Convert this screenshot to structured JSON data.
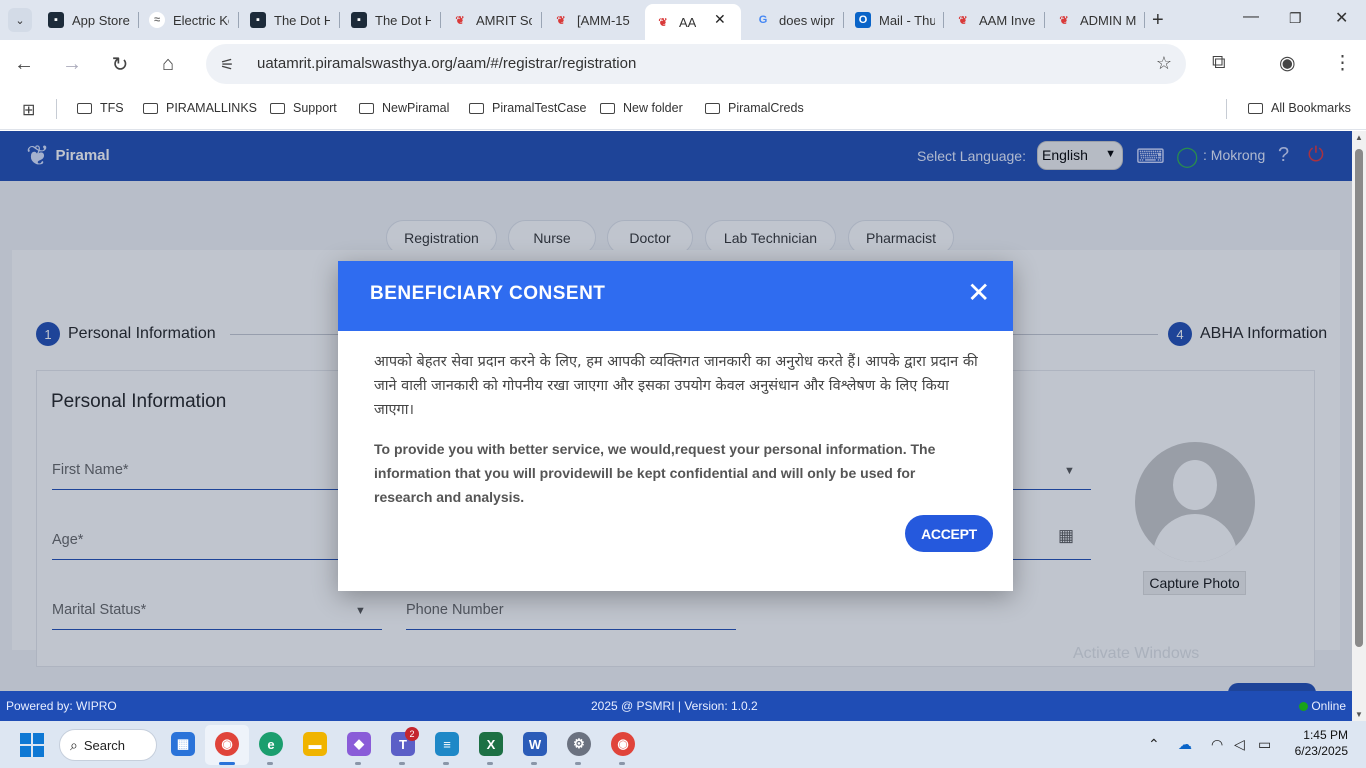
{
  "browser": {
    "tabs": [
      {
        "title": "App Store",
        "icon": "app-store-icon"
      },
      {
        "title": "Electric Ke",
        "icon": "electric-icon"
      },
      {
        "title": "The Dot H",
        "icon": "dot-icon"
      },
      {
        "title": "The Dot H",
        "icon": "dot-icon"
      },
      {
        "title": "AMRIT Sc",
        "icon": "amrit-icon"
      },
      {
        "title": "[AMM-15",
        "icon": "amrit-icon"
      },
      {
        "title": "AA",
        "icon": "amrit-icon",
        "active": true
      },
      {
        "title": "does wipr",
        "icon": "google-icon"
      },
      {
        "title": "Mail - Thu",
        "icon": "outlook-icon"
      },
      {
        "title": "AAM Inve",
        "icon": "amrit-icon"
      },
      {
        "title": "ADMIN M",
        "icon": "amrit-icon"
      }
    ],
    "close_glyph": "✕",
    "new_tab_glyph": "+",
    "url": "uatamrit.piramalswasthya.org/aam/#/registrar/registration",
    "bookmarks": [
      "TFS",
      "PIRAMALLINKS",
      "Support",
      "NewPiramal",
      "PiramalTestCase",
      "New folder",
      "PiramalCreds"
    ],
    "all_bookmarks": "All Bookmarks"
  },
  "app": {
    "brand": "Piramal",
    "language_label": "Select Language:",
    "language_value": "English",
    "user_label": ": Mokrong",
    "role_tabs": [
      "Registration",
      "Nurse",
      "Doctor",
      "Lab Technician",
      "Pharmacist"
    ],
    "steps": [
      {
        "num": "1",
        "label": "Personal Information"
      },
      {
        "num": "4",
        "label": "ABHA Information"
      }
    ],
    "form_title": "Personal Information",
    "fields": {
      "first_name": "First Name*",
      "age": "Age*",
      "marital_status": "Marital Status*",
      "phone_number": "Phone Number"
    },
    "capture_photo": "Capture Photo",
    "watermark": "Activate Windows",
    "footer": {
      "powered_by": "Powered by: WIPRO",
      "version": "2025 @ PSMRI  |  Version: 1.0.2",
      "status": "Online"
    }
  },
  "dialog": {
    "title": "BENEFICIARY CONSENT",
    "close_glyph": "✕",
    "hindi_text": "आपको बेहतर सेवा प्रदान करने के लिए, हम आपकी व्यक्तिगत जानकारी का अनुरोध करते हैं। आपके द्वारा प्रदान की जाने वाली जानकारी को गोपनीय रखा जाएगा और इसका उपयोग केवल अनुसंधान और विश्लेषण के लिए किया जाएगा।",
    "english_text": "To provide you with better service, we would,request your personal information. The information that you will providewill be kept confidential and will only be used for research and analysis.",
    "accept_label": "ACCEPT"
  },
  "taskbar": {
    "search_label": "Search",
    "teams_badge": "2",
    "time": "1:45 PM",
    "date": "6/23/2025"
  },
  "colors": {
    "header_blue": "#1f4db5",
    "dialog_blue": "#2f6cf0",
    "accept_blue": "#2559dd"
  }
}
